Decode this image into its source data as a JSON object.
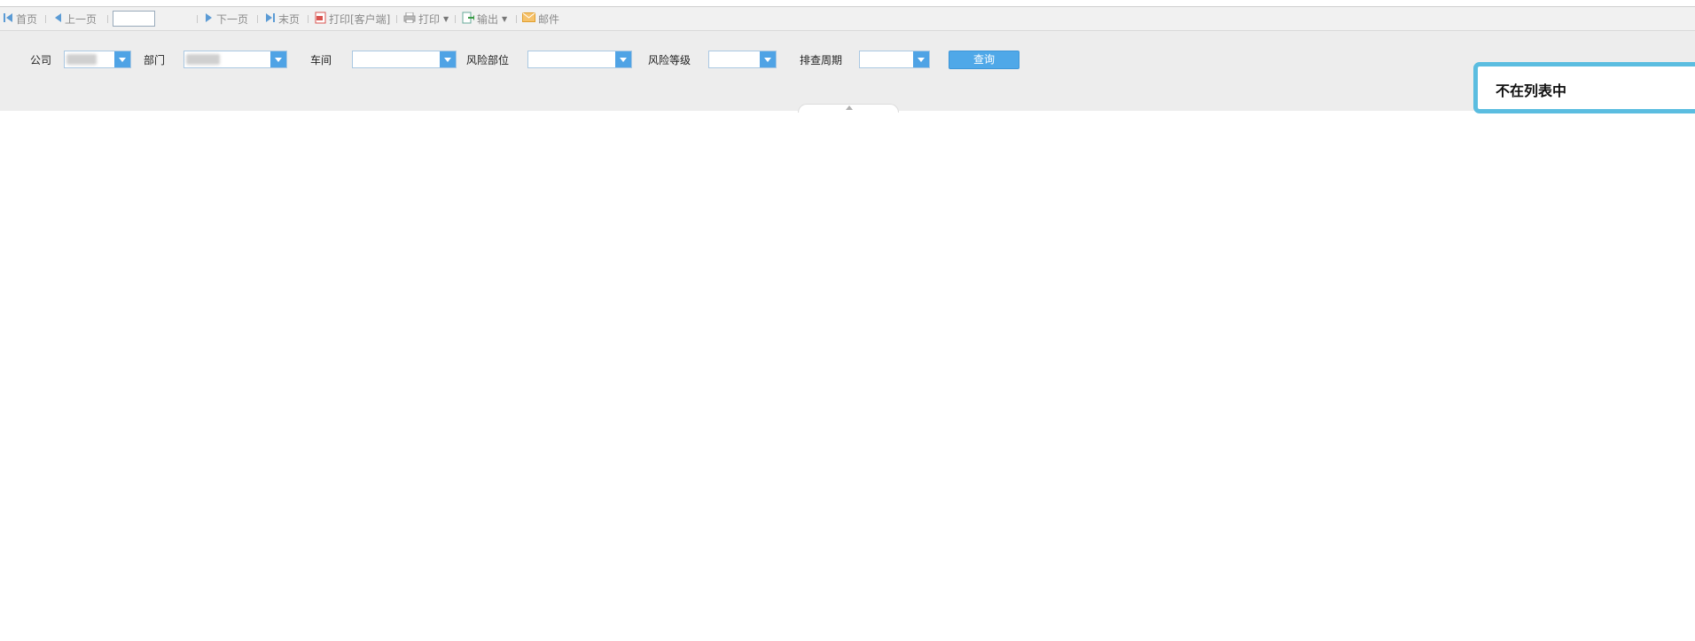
{
  "toolbar": {
    "first": "首页",
    "prev": "上一页",
    "page_value": "",
    "next": "下一页",
    "last": "末页",
    "print_client": "打印[客户端]",
    "print": "打印",
    "export": "输出",
    "mail": "邮件"
  },
  "filters": {
    "company": {
      "label": "公司",
      "value": ""
    },
    "department": {
      "label": "部门",
      "value": ""
    },
    "workshop": {
      "label": "车间",
      "value": ""
    },
    "risk_location": {
      "label": "风险部位",
      "value": ""
    },
    "risk_level": {
      "label": "风险等级",
      "value": ""
    },
    "check_cycle": {
      "label": "排查周期",
      "value": ""
    },
    "query_button": "查询"
  },
  "notice": {
    "message": "不在列表中"
  },
  "colors": {
    "accent": "#4fa3e5",
    "notice_border": "#5bbde0",
    "panel_bg": "#ededed"
  }
}
